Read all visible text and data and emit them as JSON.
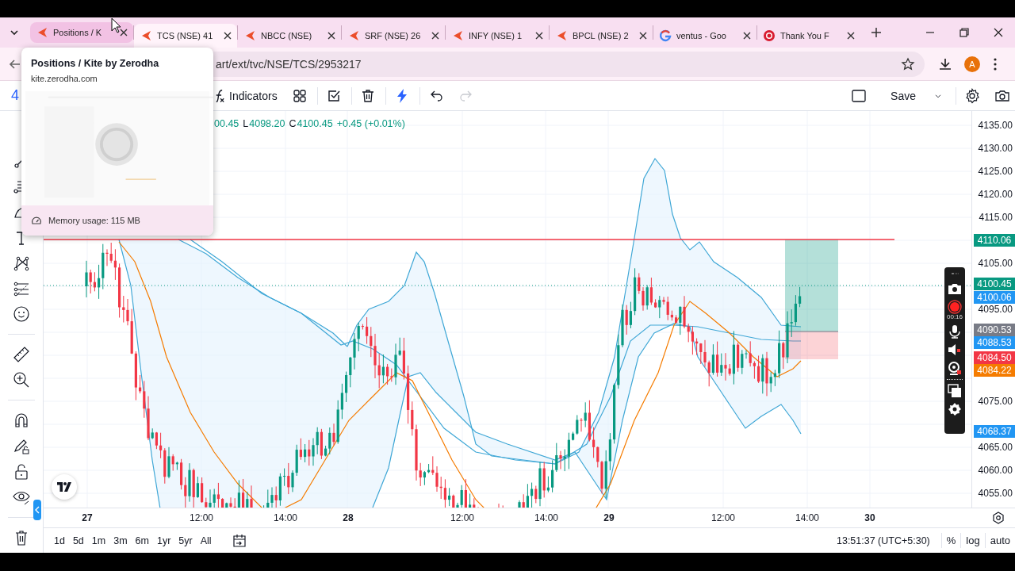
{
  "browser": {
    "tabs": [
      {
        "label": "Positions / K",
        "kind": "kite",
        "selected": false,
        "hovered": true
      },
      {
        "label": "TCS (NSE) 41",
        "kind": "kite",
        "selected": true,
        "hovered": false
      },
      {
        "label": "NBCC (NSE)",
        "kind": "kite",
        "selected": false,
        "hovered": false
      },
      {
        "label": "SRF (NSE) 26",
        "kind": "kite",
        "selected": false,
        "hovered": false
      },
      {
        "label": "INFY (NSE) 1",
        "kind": "kite",
        "selected": false,
        "hovered": false
      },
      {
        "label": "BPCL (NSE) 2",
        "kind": "kite",
        "selected": false,
        "hovered": false
      },
      {
        "label": "ventus - Goo",
        "kind": "google",
        "selected": false,
        "hovered": false
      },
      {
        "label": "Thank You F",
        "kind": "record",
        "selected": false,
        "hovered": false
      }
    ],
    "address": "art/ext/tvc/NSE/TCS/2953217",
    "profile_initial": "A"
  },
  "hover_card": {
    "title": "Positions / Kite by Zerodha",
    "url": "kite.zerodha.com",
    "memory": "Memory usage: 115 MB"
  },
  "toolbar": {
    "interval": "4",
    "indicators": "Indicators",
    "save": "Save"
  },
  "legend": [
    {
      "kind": "value",
      "text": "00.45"
    },
    {
      "kind": "label",
      "text": "L"
    },
    {
      "kind": "value",
      "text": "4098.20"
    },
    {
      "kind": "label",
      "text": "C"
    },
    {
      "kind": "value",
      "text": "4100.45"
    },
    {
      "kind": "value",
      "text": "+0.45 (+0.01%)"
    }
  ],
  "price_axis": {
    "ticks": [
      "4135.00",
      "4130.00",
      "4125.00",
      "4120.00",
      "4115.00",
      "4105.00",
      "4095.00",
      "4075.00",
      "4065.00",
      "4060.00",
      "4055.00"
    ],
    "badges": [
      {
        "text": "4110.06",
        "color": "#089981"
      },
      {
        "text": "4100.45",
        "color": "#089981"
      },
      {
        "text": "4100.06",
        "color": "#2196f3"
      },
      {
        "text": "4090.53",
        "color": "#787b86"
      },
      {
        "text": "4088.53",
        "color": "#2196f3"
      },
      {
        "text": "4084.50",
        "color": "#f23645"
      },
      {
        "text": "4084.22",
        "color": "#f57c00"
      },
      {
        "text": "4068.37",
        "color": "#2196f3"
      }
    ]
  },
  "time_axis": [
    {
      "label": "27",
      "kind": "day"
    },
    {
      "label": "12:00",
      "kind": "time"
    },
    {
      "label": "14:00",
      "kind": "time"
    },
    {
      "label": "28",
      "kind": "day"
    },
    {
      "label": "12:00",
      "kind": "time"
    },
    {
      "label": "14:00",
      "kind": "time"
    },
    {
      "label": "29",
      "kind": "day"
    },
    {
      "label": "12:00",
      "kind": "time"
    },
    {
      "label": "14:00",
      "kind": "time"
    },
    {
      "label": "30",
      "kind": "day"
    }
  ],
  "range_buttons": [
    "1d",
    "5d",
    "1m",
    "3m",
    "6m",
    "1yr",
    "5yr",
    "All"
  ],
  "clock": "13:51:37 (UTC+5:30)",
  "scale_options": [
    "%",
    "log",
    "auto"
  ],
  "recorder": {
    "elapsed": "00:16"
  }
}
